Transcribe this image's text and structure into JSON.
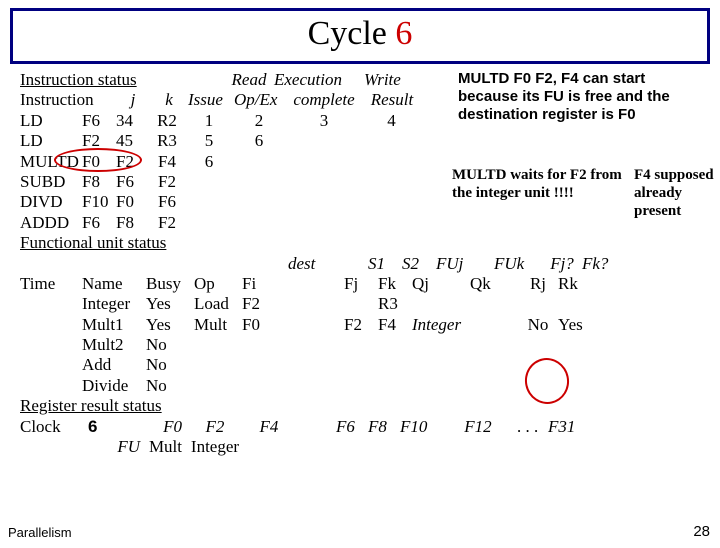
{
  "title": {
    "word1": "Cycle",
    "word2": "6"
  },
  "notes": {
    "n1": "MULTD F0 F2, F4 can start because its FU is free and the destination register is F0",
    "n2a": "MULTD waits for F2 from the integer unit !!!!",
    "n2b": "F4 supposed already present"
  },
  "section1": "Instruction status",
  "ih1": {
    "read": "Read",
    "exec": "Execution",
    "write": "Write"
  },
  "ih2": {
    "instr": "Instruction",
    "j": "j",
    "k": "k",
    "issue": "Issue",
    "opex": "Op/Ex",
    "complete": "complete",
    "result": "Result"
  },
  "instrs": [
    {
      "op": "LD",
      "r": "F6",
      "j": "34",
      "k": "R2",
      "is": "1",
      "ro": "2",
      "ex": "3",
      "wr": "4"
    },
    {
      "op": "LD",
      "r": "F2",
      "j": "45",
      "k": "R3",
      "is": "5",
      "ro": "6",
      "ex": "",
      "wr": ""
    },
    {
      "op": "MULTD",
      "r": "F0",
      "j": "F2",
      "k": "F4",
      "is": "6",
      "ro": "",
      "ex": "",
      "wr": ""
    },
    {
      "op": "SUBD",
      "r": "F8",
      "j": "F6",
      "k": "F2",
      "is": "",
      "ro": "",
      "ex": "",
      "wr": ""
    },
    {
      "op": "DIVD",
      "r": "F10",
      "j": "F0",
      "k": "F6",
      "is": "",
      "ro": "",
      "ex": "",
      "wr": ""
    },
    {
      "op": "ADDD",
      "r": "F6",
      "j": "F8",
      "k": "F2",
      "is": "",
      "ro": "",
      "ex": "",
      "wr": ""
    }
  ],
  "section2": "Functional unit status",
  "fh1": {
    "dest": "dest",
    "s1": "S1",
    "s2": "S2",
    "fuj": "FUj",
    "fuk": "FUk",
    "fjq": "Fj?",
    "fkq": "Fk?"
  },
  "fh2": {
    "time": "Time",
    "name": "Name",
    "busy": "Busy",
    "op": "Op",
    "fi": "Fi",
    "fj": "Fj",
    "fk": "Fk",
    "qj": "Qj",
    "qk": "Qk",
    "rj": "Rj",
    "rk": "Rk"
  },
  "fus": [
    {
      "t": "",
      "n": "Integer",
      "b": "Yes",
      "o": "Load",
      "fi": "F2",
      "fj": "",
      "fk": "R3",
      "qj": "",
      "qk": "",
      "rj": "",
      "rk": ""
    },
    {
      "t": "",
      "n": "Mult1",
      "b": "Yes",
      "o": "Mult",
      "fi": "F0",
      "fj": "F2",
      "fk": "F4",
      "qj": "Integer",
      "qk": "",
      "rj": "No",
      "rk": "Yes"
    },
    {
      "t": "",
      "n": "Mult2",
      "b": "No",
      "o": "",
      "fi": "",
      "fj": "",
      "fk": "",
      "qj": "",
      "qk": "",
      "rj": "",
      "rk": ""
    },
    {
      "t": "",
      "n": "Add",
      "b": "No",
      "o": "",
      "fi": "",
      "fj": "",
      "fk": "",
      "qj": "",
      "qk": "",
      "rj": "",
      "rk": ""
    },
    {
      "t": "",
      "n": "Divide",
      "b": "No",
      "o": "",
      "fi": "",
      "fj": "",
      "fk": "",
      "qj": "",
      "qk": "",
      "rj": "",
      "rk": ""
    }
  ],
  "section3": "Register result status",
  "rr": {
    "clock": "Clock",
    "clockv": "6",
    "fuLab": "FU",
    "heads": [
      "F0",
      "F2",
      "F4",
      "",
      "F6",
      "F8",
      "F10",
      "F12",
      ". . .",
      "F31"
    ],
    "vals": [
      "Mult",
      "Integer",
      "",
      "",
      "",
      "",
      "",
      "",
      "",
      ""
    ]
  },
  "footer": {
    "left": "Parallelism",
    "right": "28"
  }
}
